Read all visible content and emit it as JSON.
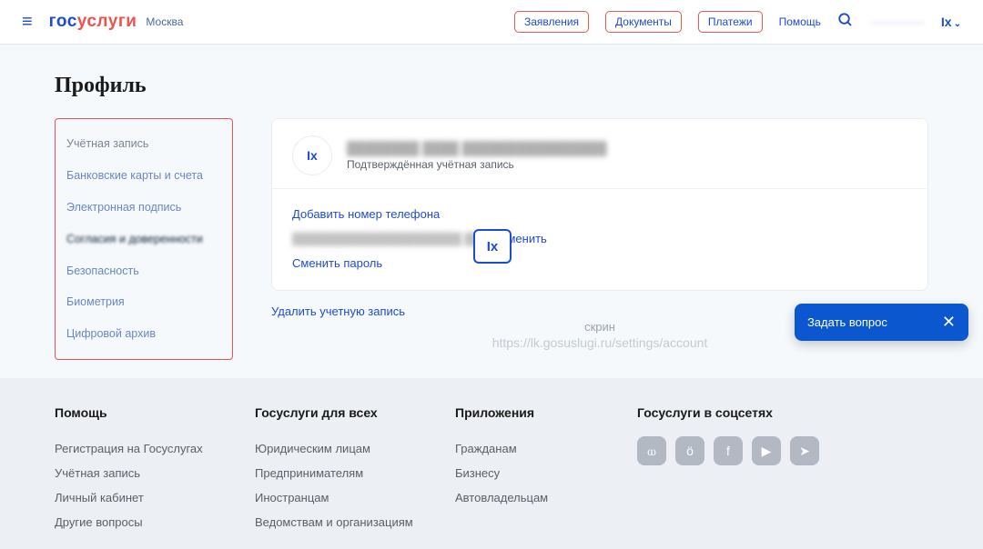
{
  "header": {
    "burger": "≡",
    "logo_b": "гос",
    "logo_r": "услуги",
    "region": "Москва",
    "pills": [
      "Заявления",
      "Документы",
      "Платежи"
    ],
    "help": "Помощь",
    "blurchip": "—————",
    "user": "Ix"
  },
  "page": {
    "title": "Профиль"
  },
  "sidebar": {
    "items": [
      "Учётная запись",
      "Банковские карты и счета",
      "Электронная подпись",
      "Согласия и доверенности",
      "Безопасность",
      "Биометрия",
      "Цифровой архив"
    ],
    "activeIndex": 3
  },
  "card": {
    "avatar": "Ix",
    "name_blur": "████████ ████ ████████████████",
    "status": "Подтверждённая учётная запись",
    "add_phone": "Добавить номер телефона",
    "email_blur": "█████████████████████.██",
    "change": "Изменить",
    "change_pass": "Сменить пароль"
  },
  "delete_link": "Удалить учетную запись",
  "caption": "скрин",
  "url": "https://lk.gosuslugi.ru/settings/account",
  "badge": "Ix",
  "ask": {
    "text": "Задать вопрос",
    "close": "✕"
  },
  "footer": {
    "col1": {
      "h": "Помощь",
      "items": [
        "Регистрация на Госуслугах",
        "Учётная запись",
        "Личный кабинет",
        "Другие вопросы"
      ]
    },
    "col2": {
      "h": "Госуслуги для всех",
      "items": [
        "Юридическим лицам",
        "Предпринимателям",
        "Иностранцам",
        "Ведомствам и организациям"
      ]
    },
    "col3": {
      "h": "Приложения",
      "items": [
        "Гражданам",
        "Бизнесу",
        "Автовладельцам"
      ]
    },
    "col4": {
      "h": "Госуслуги в соцсетях"
    },
    "social": [
      "vk-icon",
      "ok-icon",
      "facebook-icon",
      "youtube-icon",
      "telegram-icon"
    ],
    "social_glyphs": [
      "ⲱ",
      "ӧ",
      "f",
      "▶",
      "➤"
    ]
  }
}
